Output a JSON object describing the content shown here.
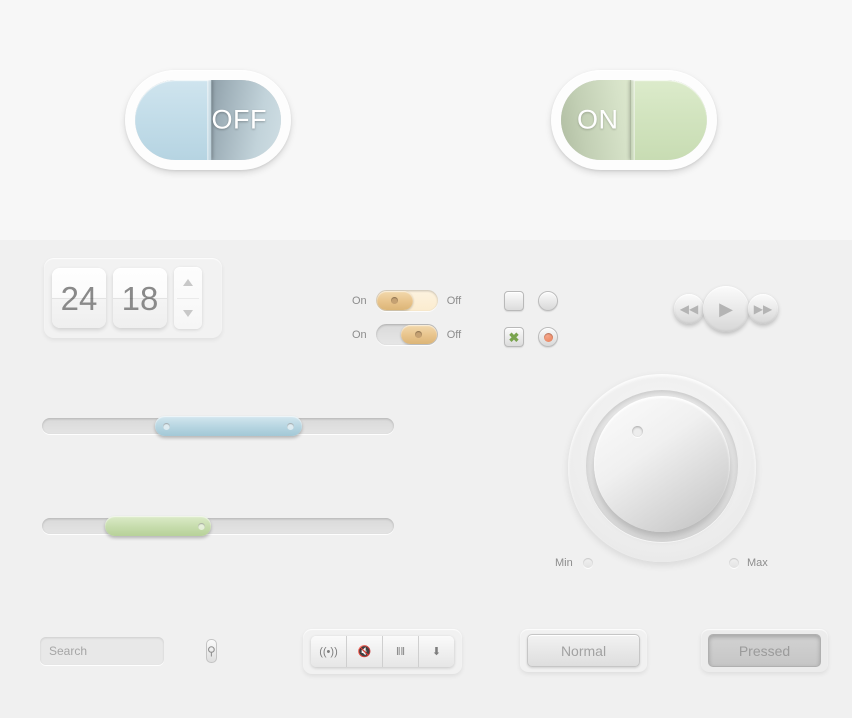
{
  "toggles": {
    "off": {
      "label": "OFF",
      "state": "off",
      "color": "#c3dde9"
    },
    "on": {
      "label": "ON",
      "state": "on",
      "color": "#d2e4bf"
    }
  },
  "stepper": {
    "value_left": "24",
    "value_right": "18",
    "up_arrow": "increment-arrow",
    "down_arrow": "decrement-arrow"
  },
  "mini_toggles": [
    {
      "on_label": "On",
      "off_label": "Off",
      "state": "on",
      "knob_side": "left",
      "fill": "#fbeccf"
    },
    {
      "on_label": "On",
      "off_label": "Off",
      "state": "off",
      "knob_side": "right",
      "fill": "#dadada"
    }
  ],
  "choices": {
    "checkbox_unchecked": {
      "name": "checkbox-unchecked",
      "mark": ""
    },
    "radio_unselected": {
      "name": "radio-unselected",
      "mark": ""
    },
    "checkbox_checked": {
      "name": "checkbox-checked",
      "mark": "✖",
      "mark_color": "#7aa44e"
    },
    "radio_selected": {
      "name": "radio-selected",
      "dot_color": "#e87f58"
    }
  },
  "transport": {
    "rewind": {
      "icon": "rewind-icon",
      "glyph": "◀◀"
    },
    "play": {
      "icon": "play-icon",
      "glyph": "▶"
    },
    "forward": {
      "icon": "fast-forward-icon",
      "glyph": "▶▶"
    }
  },
  "sliders": [
    {
      "name": "blue-range-slider",
      "color": "#b6d5e1",
      "handle_left_pct": 32,
      "handle_width_pct": 42,
      "screws": 2
    },
    {
      "name": "green-range-slider",
      "color": "#c6dcac",
      "handle_left_pct": 18,
      "handle_width_pct": 30,
      "screws": 1
    }
  ],
  "knob": {
    "min_label": "Min",
    "max_label": "Max",
    "indicator": "knob-position-indicator"
  },
  "search": {
    "placeholder": "Search",
    "value": "",
    "button_icon": "search-icon",
    "button_glyph": "⚲"
  },
  "segmented_toolbar": {
    "buttons": [
      {
        "name": "wireless-icon",
        "glyph": "((•))"
      },
      {
        "name": "mute-icon",
        "glyph": "🔇"
      },
      {
        "name": "equalizer-icon",
        "glyph": "‖‖"
      },
      {
        "name": "download-icon",
        "glyph": "⬇"
      }
    ]
  },
  "push_buttons": [
    {
      "name": "normal-button",
      "label": "Normal",
      "state": "normal"
    },
    {
      "name": "pressed-button",
      "label": "Pressed",
      "state": "pressed"
    }
  ],
  "palette": {
    "band_top": "#f7f7f7",
    "band_main": "#f0f0f0"
  }
}
